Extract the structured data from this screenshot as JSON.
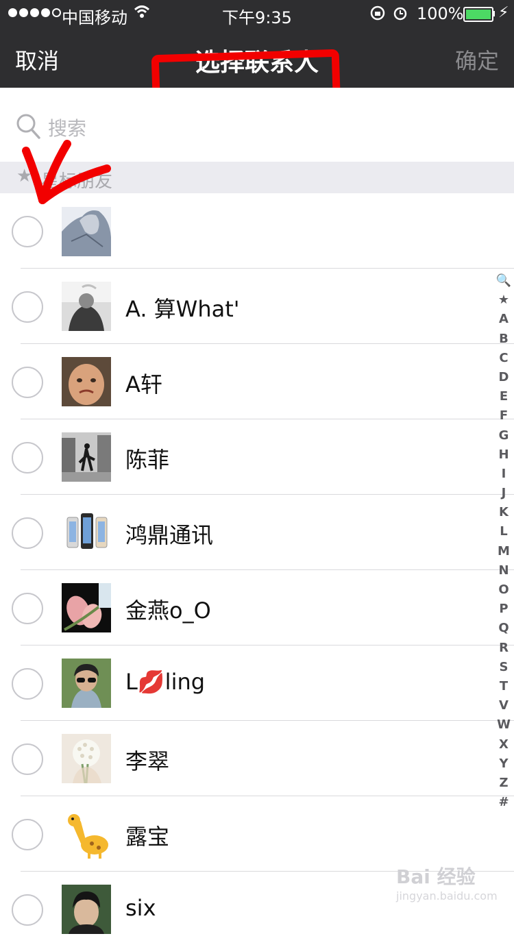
{
  "status_bar": {
    "carrier": "中国移动",
    "time": "下午9:35",
    "battery": "100%"
  },
  "nav": {
    "cancel": "取消",
    "title": "选择联系人",
    "confirm": "确定"
  },
  "search": {
    "placeholder": "搜索"
  },
  "section": {
    "star": "★",
    "label": "星标朋友"
  },
  "contacts": [
    {
      "name": ""
    },
    {
      "name": "A. 算What'"
    },
    {
      "name": "A轩"
    },
    {
      "name": "陈菲"
    },
    {
      "name": "鸿鼎通讯"
    },
    {
      "name": "金燕o_O"
    },
    {
      "name": "L💋ling"
    },
    {
      "name": "李翠"
    },
    {
      "name": "露宝"
    },
    {
      "name": "six"
    }
  ],
  "index_letters": [
    "🔍",
    "★",
    "A",
    "B",
    "C",
    "D",
    "E",
    "F",
    "G",
    "H",
    "I",
    "J",
    "K",
    "L",
    "M",
    "N",
    "O",
    "P",
    "Q",
    "R",
    "S",
    "T",
    "V",
    "W",
    "X",
    "Y",
    "Z",
    "#"
  ],
  "watermark": "Bai 经验",
  "watermark_sub": "jingyan.baidu.com",
  "colors": {
    "nav_bg": "#2e2e30",
    "annotation": "#f20000",
    "section_bg": "#ebebf0",
    "battery": "#4cd964"
  }
}
